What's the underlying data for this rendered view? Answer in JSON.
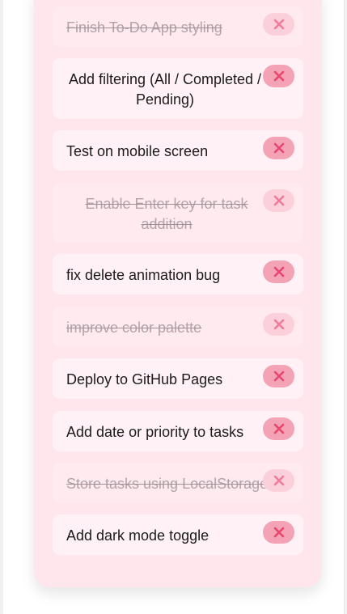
{
  "tasks": [
    {
      "text": "Finish To-Do App styling",
      "completed": true
    },
    {
      "text": "Add filtering (All / Completed / Pending)",
      "completed": false
    },
    {
      "text": "Test on mobile screen",
      "completed": false
    },
    {
      "text": "Enable Enter key for task addition",
      "completed": true
    },
    {
      "text": "fix delete animation bug",
      "completed": false
    },
    {
      "text": "improve color palette",
      "completed": true
    },
    {
      "text": "Deploy to GitHub Pages",
      "completed": false
    },
    {
      "text": "Add date or priority to tasks",
      "completed": false
    },
    {
      "text": "Store tasks using LocalStorage",
      "completed": true
    },
    {
      "text": "Add dark mode toggle",
      "completed": false
    }
  ],
  "icons": {
    "delete": "close-icon"
  },
  "colors": {
    "card": "#ffe5ec",
    "task": "#fff1f5",
    "delete_button": "#f4a2b6",
    "delete_x": "#e8466e"
  }
}
